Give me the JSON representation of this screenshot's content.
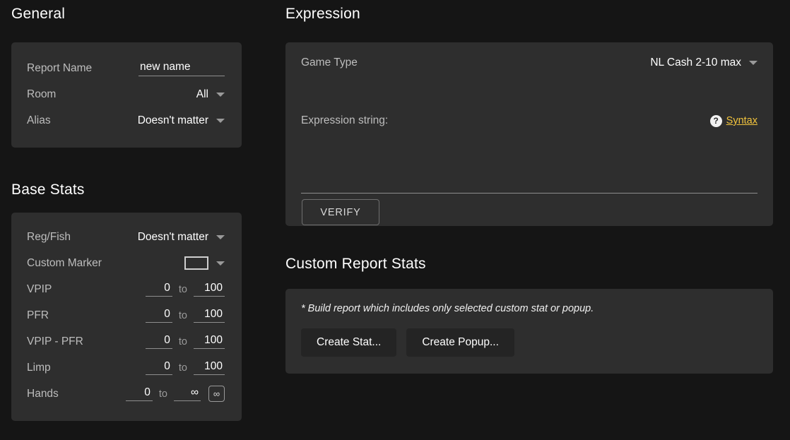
{
  "sections": {
    "general_title": "General",
    "base_stats_title": "Base Stats",
    "expression_title": "Expression",
    "custom_report_stats_title": "Custom Report Stats"
  },
  "general": {
    "report_name_label": "Report Name",
    "report_name_value": "new name",
    "report_name_placeholder": "new name",
    "room_label": "Room",
    "room_value": "All",
    "alias_label": "Alias",
    "alias_value": "Doesn't matter"
  },
  "base_stats": {
    "reg_fish_label": "Reg/Fish",
    "reg_fish_value": "Doesn't matter",
    "custom_marker_label": "Custom Marker",
    "custom_marker_color": "#2e2e2e",
    "to_label": "to",
    "ranges": [
      {
        "label": "VPIP",
        "min": "0",
        "max": "100"
      },
      {
        "label": "PFR",
        "min": "0",
        "max": "100"
      },
      {
        "label": "VPIP - PFR",
        "min": "0",
        "max": "100"
      },
      {
        "label": "Limp",
        "min": "0",
        "max": "100"
      }
    ],
    "hands": {
      "label": "Hands",
      "min": "0",
      "max": "∞",
      "infinity_button": "∞"
    }
  },
  "expression": {
    "game_type_label": "Game Type",
    "game_type_value": "NL Cash 2-10 max",
    "expression_string_label": "Expression string:",
    "expression_string_value": "",
    "help_icon_glyph": "?",
    "syntax_link": "Syntax",
    "verify_button": "VERIFY"
  },
  "custom_report_stats": {
    "note": "* Build report which includes only selected custom stat or popup.",
    "create_stat_button": "Create Stat...",
    "create_popup_button": "Create Popup..."
  },
  "colors": {
    "page_background": "#151515",
    "panel_background": "#2e2e2e",
    "accent_link": "#f2c43d",
    "label_text": "#bdbdbd",
    "value_text": "#ffffff",
    "button_fill": "#242424"
  }
}
